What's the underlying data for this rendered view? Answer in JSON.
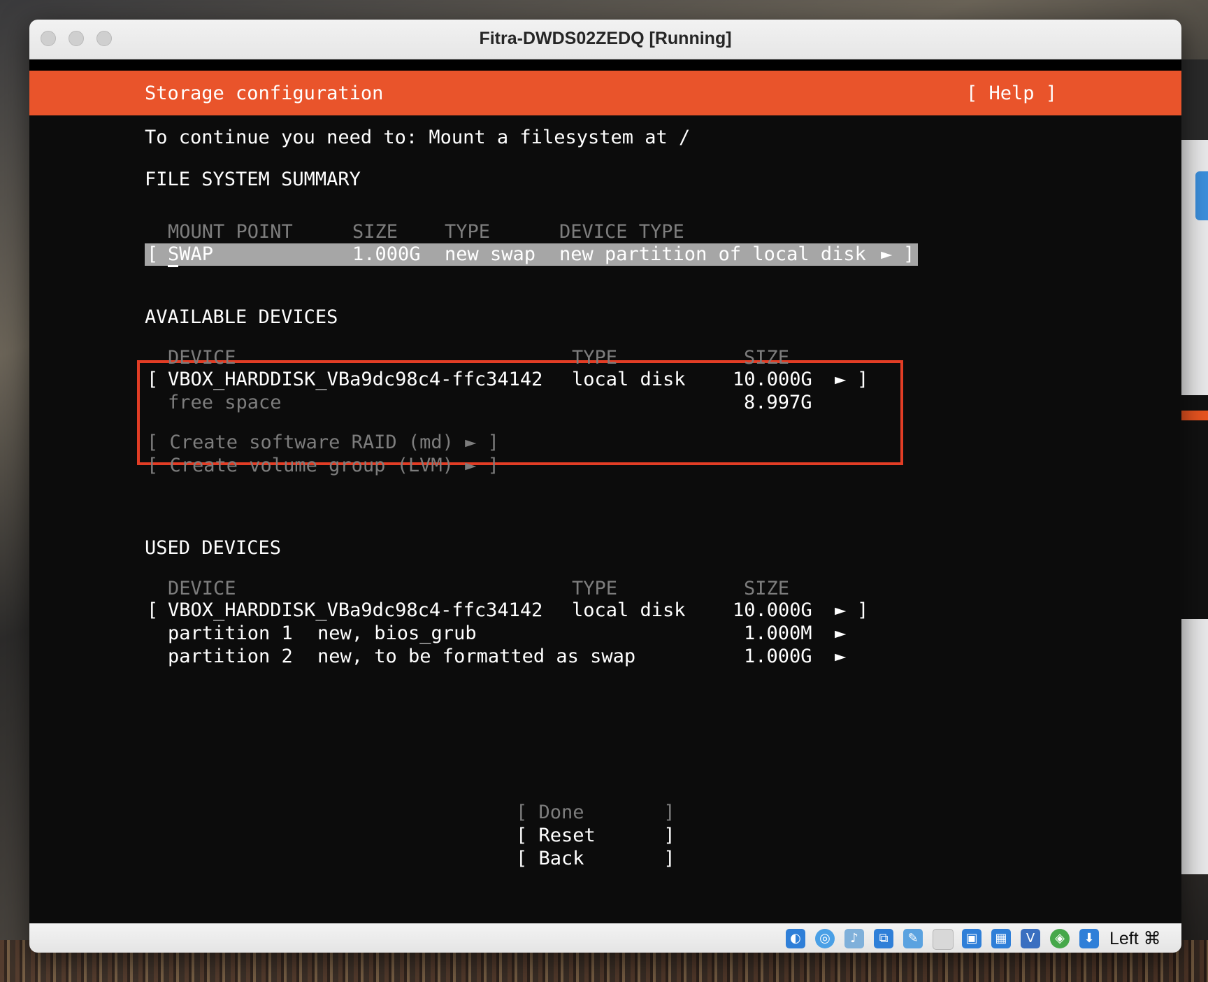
{
  "window": {
    "title": "Fitra-DWDS02ZEDQ [Running]"
  },
  "installer": {
    "header_title": "Storage configuration",
    "help_button": "[ Help ]",
    "instruction": "To continue you need to: Mount a filesystem at /",
    "fs_summary": {
      "heading": "FILE SYSTEM SUMMARY",
      "columns": [
        "MOUNT POINT",
        "SIZE",
        "TYPE",
        "DEVICE TYPE"
      ],
      "rows": [
        {
          "open_bracket": "[",
          "mount_point": "SWAP",
          "size": "1.000G",
          "type": "new swap",
          "device_type": "new partition of local disk",
          "arrow": "►",
          "close_bracket": "]"
        }
      ]
    },
    "available_devices": {
      "heading": "AVAILABLE DEVICES",
      "columns": [
        "DEVICE",
        "TYPE",
        "SIZE"
      ],
      "disk": {
        "open_bracket": "[",
        "device": "VBOX_HARDDISK_VBa9dc98c4-ffc34142",
        "type": "local disk",
        "size": "10.000G",
        "arrow": "►",
        "close_bracket": "]"
      },
      "free_space": {
        "label": "free space",
        "size": "8.997G"
      },
      "actions": [
        "[ Create software RAID (md) ► ]",
        "[ Create volume group (LVM) ► ]"
      ]
    },
    "used_devices": {
      "heading": "USED DEVICES",
      "columns": [
        "DEVICE",
        "TYPE",
        "SIZE"
      ],
      "disk": {
        "open_bracket": "[",
        "device": "VBOX_HARDDISK_VBa9dc98c4-ffc34142",
        "type": "local disk",
        "size": "10.000G",
        "arrow": "►",
        "close_bracket": "]"
      },
      "partitions": [
        {
          "name": "partition 1",
          "desc": "new, bios_grub",
          "size": "1.000M",
          "arrow": "►"
        },
        {
          "name": "partition 2",
          "desc": "new, to be formatted as swap",
          "size": "1.000G",
          "arrow": "►"
        }
      ]
    },
    "buttons": {
      "done": "[ Done       ]",
      "reset": "[ Reset      ]",
      "back": "[ Back       ]"
    }
  },
  "statusbar": {
    "icons": [
      "hard-disk-icon",
      "optical-disk-icon",
      "audio-icon",
      "network-icon",
      "usb-icon",
      "shared-folder-icon",
      "display-icon",
      "recording-icon",
      "drag-drop-icon",
      "cpu-icon",
      "mouse-integration-icon"
    ],
    "host_key": "Left ⌘"
  },
  "colors": {
    "accent": "#e9542b",
    "terminal_bg": "#0c0c0c",
    "highlight_box": "#e23d25"
  }
}
